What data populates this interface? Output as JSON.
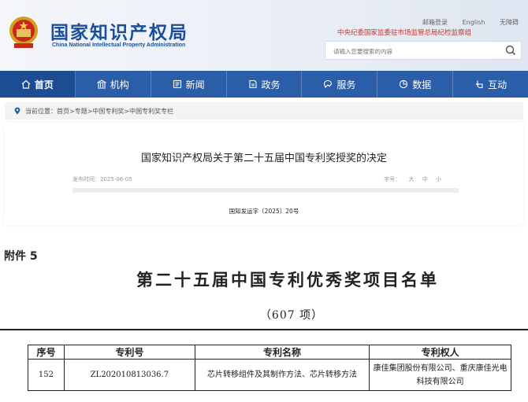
{
  "header": {
    "site_title": "国家知识产权局",
    "site_subtitle": "China National Intellectual Property Administration",
    "top_links": [
      "邮箱登录",
      "English",
      "无障碍"
    ],
    "discipline_text": "中央纪委国家监委驻市场监管总局纪检监察组",
    "search_placeholder": "请输入您要搜索的内容",
    "brand_color": "#2a5ea8"
  },
  "nav": {
    "items": [
      {
        "label": "首页",
        "icon": "home-icon"
      },
      {
        "label": "机构",
        "icon": "institution-icon"
      },
      {
        "label": "新闻",
        "icon": "news-icon"
      },
      {
        "label": "政务",
        "icon": "affairs-icon"
      },
      {
        "label": "服务",
        "icon": "service-icon"
      },
      {
        "label": "数据",
        "icon": "data-icon"
      },
      {
        "label": "互动",
        "icon": "interact-icon"
      }
    ],
    "active_index": 0
  },
  "breadcrumb": {
    "prefix": "当前位置：",
    "items": [
      "首页",
      "专题",
      "中国专利奖",
      "中国专利奖专栏"
    ]
  },
  "article": {
    "title": "国家知识产权局关于第二十五届中国专利奖授奖的决定",
    "publish_date": "发布时间：2025-06-05",
    "font_size_label": "字号：",
    "font_sizes": [
      "大",
      "中",
      "小"
    ],
    "doc_number": "国知发运字〔2025〕20号"
  },
  "document": {
    "attachment": "附件 5",
    "list_title": "第二十五届中国专利优秀奖项目名单",
    "count": "（607 项）",
    "table": {
      "headers": [
        "序号",
        "专利号",
        "专利名称",
        "专利权人"
      ],
      "rows": [
        {
          "no": "152",
          "patent_no": "ZL202010813036.7",
          "name": "芯片转移组件及其制作方法、芯片转移方法",
          "holder": "康佳集团股份有限公司、重庆康佳光电科技有限公司"
        }
      ]
    }
  }
}
